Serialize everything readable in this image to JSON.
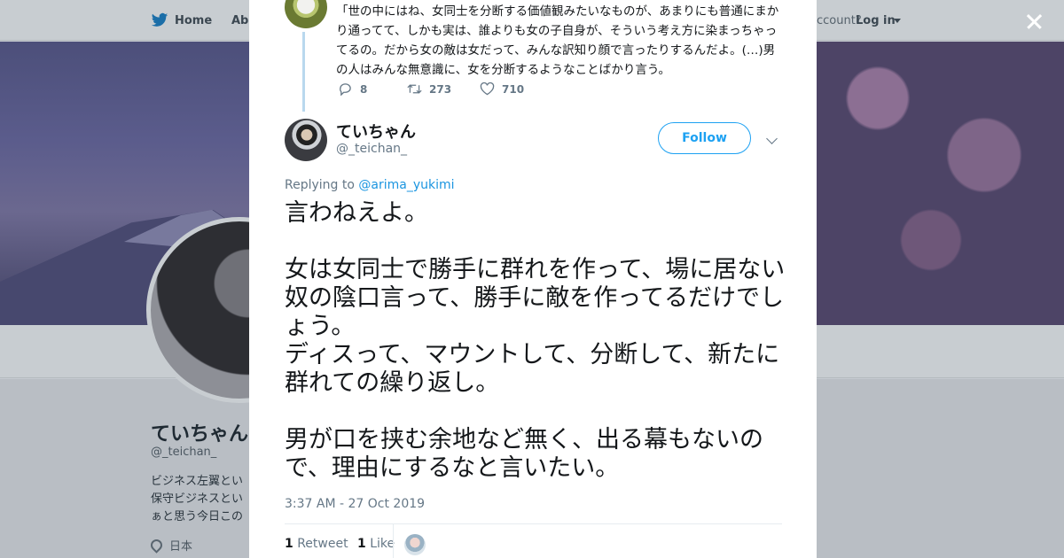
{
  "background_page": {
    "nav": {
      "home": "Home",
      "about": "Abo",
      "have_account": "ccount?",
      "login": "Log in"
    },
    "profile": {
      "name": "ていちゃん",
      "handle": "@_teichan_",
      "bio_lines": [
        "ビジネス左翼とい",
        "保守ビジネスとい",
        "ぁと思う今日この"
      ],
      "location": "日本"
    }
  },
  "modal": {
    "previous_tweet": {
      "text": "「世の中にはね、女同士を分断する価値観みたいなものが、あまりにも普通にまかり通ってて、しかも実は、誰よりも女の子自身が、そういう考え方に染まっちゃってるの。だから女の敵は女だって、みんな訳知り顔で言ったりするんだよ。(…)男の人はみんな無意識に、女を分断するようなことばかり言う。",
      "replies": "8",
      "retweets": "273",
      "likes": "710"
    },
    "author": {
      "name": "ていちゃん",
      "handle": "@_teichan_"
    },
    "follow_label": "Follow",
    "replying_prefix": "Replying to",
    "replying_to": "@arima_yukimi",
    "tweet_text": "言わねえよ。\n\n女は女同士で勝手に群れを作って、場に居ない奴の陰口言って、勝手に敵を作ってるだけでしょう。\nディスって、マウントして、分断して、新たに群れての繰り返し。\n\n男が口を挟む余地など無く、出る幕もないので、理由にするなと言いたい。",
    "timestamp": "3:37 AM - 27 Oct 2019",
    "stats": {
      "retweets_count": "1",
      "retweets_label": "Retweet",
      "likes_count": "1",
      "likes_label": "Like"
    }
  },
  "colors": {
    "accent": "#1da1f2",
    "link": "#1b95e0",
    "secondary_text": "#657786",
    "thread_line": "#b9d8ee"
  },
  "icons": [
    "twitter-bird-icon",
    "close-icon",
    "reply-icon",
    "retweet-icon",
    "like-icon",
    "chevron-down-icon",
    "location-icon"
  ]
}
